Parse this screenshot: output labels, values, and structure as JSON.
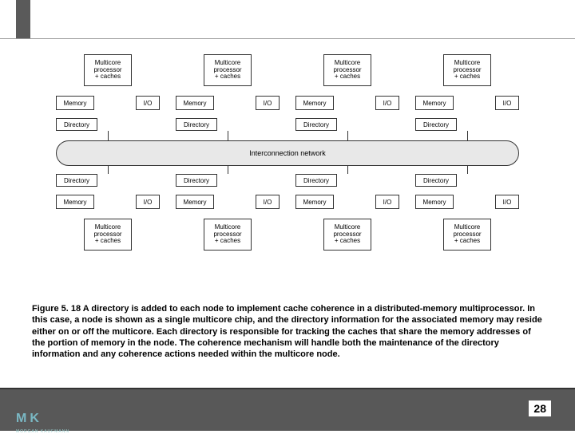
{
  "diagram": {
    "processor_label": "Multicore\nprocessor\n+ caches",
    "memory_label": "Memory",
    "io_label": "I/O",
    "directory_label": "Directory",
    "interconnect_label": "Interconnection network",
    "num_nodes_top": 4,
    "num_nodes_bottom": 4
  },
  "caption": "Figure 5. 18 A directory is added to each node to implement cache coherence in a distributed-memory multiprocessor. In this case, a node is shown as a single multicore chip, and the directory information for the associated memory may reside either on or off the multicore. Each directory is responsible for tracking the caches that share the memory addresses of the portion of memory in the node. The coherence mechanism will handle both the maintenance of the directory information and any coherence actions needed within the multicore node.",
  "logo": {
    "text": "MK",
    "sub": "MORGAN KAUFMANN"
  },
  "page_number": "28"
}
